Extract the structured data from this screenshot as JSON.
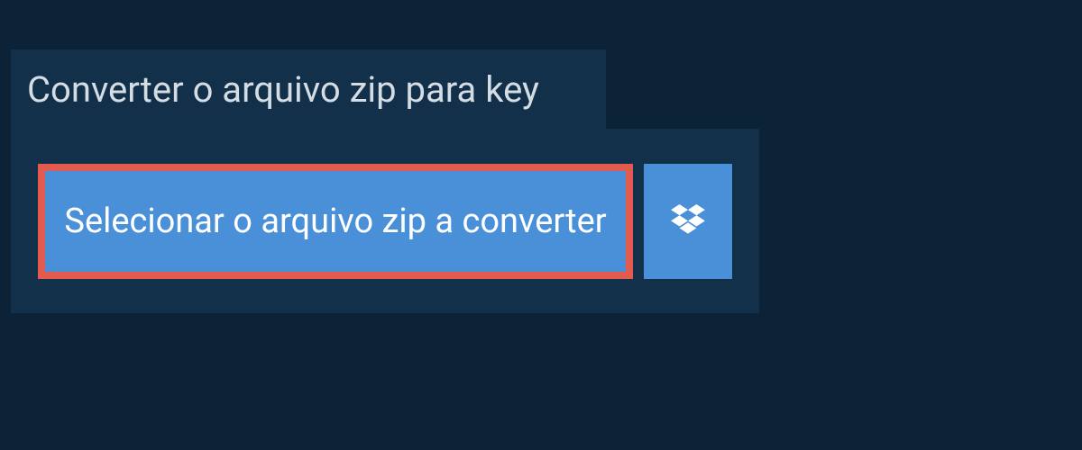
{
  "title": "Converter o arquivo zip para key",
  "buttons": {
    "select_label": "Selecionar o arquivo zip a converter"
  },
  "colors": {
    "background": "#0c2237",
    "panel": "#13304a",
    "button": "#4a90d9",
    "highlight_border": "#e35a4f",
    "text_light": "#d5dde4",
    "text_white": "#ffffff"
  }
}
